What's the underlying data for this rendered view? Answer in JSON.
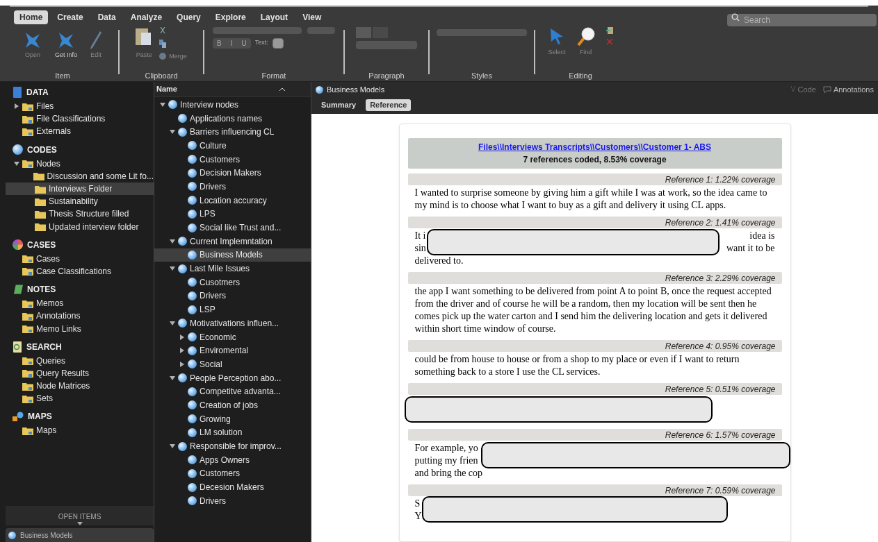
{
  "ribbon": {
    "tabs": [
      {
        "label": "Home",
        "selected": true
      },
      {
        "label": "Create",
        "selected": false
      },
      {
        "label": "Data",
        "selected": false
      },
      {
        "label": "Analyze",
        "selected": false
      },
      {
        "label": "Query",
        "selected": false
      },
      {
        "label": "Explore",
        "selected": false
      },
      {
        "label": "Layout",
        "selected": false
      },
      {
        "label": "View",
        "selected": false
      }
    ],
    "search": {
      "placeholder": "Search"
    },
    "item_buttons": [
      {
        "label": "Open",
        "disabled": true
      },
      {
        "label": "Get Info",
        "disabled": false
      },
      {
        "label": "Edit",
        "disabled": true
      }
    ],
    "clipboard": {
      "paste": "Paste",
      "merge": "Merge"
    },
    "format": {
      "bold": "B",
      "italic": "I",
      "underline": "U",
      "text_label": "Text:"
    },
    "editing": [
      {
        "label": "Select",
        "kind": "select"
      },
      {
        "label": "Find",
        "kind": "find"
      }
    ],
    "groups": [
      "Item",
      "Clipboard",
      "Format",
      "Paragraph",
      "Styles",
      "Editing"
    ]
  },
  "sidebar": {
    "sections": [
      {
        "title": "DATA",
        "kind": "data",
        "items": [
          {
            "label": "Files",
            "expandable": true,
            "selected": false
          },
          {
            "label": "File Classifications",
            "selected": false
          },
          {
            "label": "Externals",
            "selected": false
          }
        ]
      },
      {
        "title": "CODES",
        "kind": "codes",
        "items": [
          {
            "label": "Nodes",
            "expanded": true,
            "selected": false,
            "children": [
              {
                "label": "Discussion and some Lit fo...",
                "selected": false
              },
              {
                "label": "Interviews Folder",
                "selected": true
              },
              {
                "label": "Sustainability",
                "selected": false
              },
              {
                "label": "Thesis Structure filled",
                "selected": false
              },
              {
                "label": "Updated interview folder",
                "selected": false
              }
            ]
          }
        ]
      },
      {
        "title": "CASES",
        "kind": "cases",
        "items": [
          {
            "label": "Cases",
            "selected": false
          },
          {
            "label": "Case Classifications",
            "selected": false
          }
        ]
      },
      {
        "title": "NOTES",
        "kind": "notes",
        "items": [
          {
            "label": "Memos",
            "selected": false
          },
          {
            "label": "Annotations",
            "selected": false
          },
          {
            "label": "Memo Links",
            "selected": false
          }
        ]
      },
      {
        "title": "SEARCH",
        "kind": "search",
        "items": [
          {
            "label": "Queries",
            "selected": false
          },
          {
            "label": "Query Results",
            "selected": false
          },
          {
            "label": "Node Matrices",
            "selected": false
          },
          {
            "label": "Sets",
            "selected": false
          }
        ]
      },
      {
        "title": "MAPS",
        "kind": "maps",
        "items": [
          {
            "label": "Maps",
            "selected": false
          }
        ]
      }
    ],
    "open_items": {
      "title": "OPEN ITEMS",
      "items": [
        "Business Models"
      ]
    }
  },
  "node_list": {
    "column": "Name",
    "nodes": [
      {
        "label": "Interview nodes",
        "expanded": true,
        "selected": false,
        "children": [
          {
            "label": "Applications names",
            "selected": false
          },
          {
            "label": "Barriers influencing  CL",
            "expanded": true,
            "selected": false,
            "children": [
              {
                "label": "Culture",
                "selected": false
              },
              {
                "label": "Customers",
                "selected": false
              },
              {
                "label": "Decision Makers",
                "selected": false
              },
              {
                "label": "Drivers",
                "selected": false
              },
              {
                "label": "Location accuracy",
                "selected": false
              },
              {
                "label": "LPS",
                "selected": false
              },
              {
                "label": "Social like Trust and...",
                "selected": false
              }
            ]
          },
          {
            "label": "Current Implemntation",
            "expanded": true,
            "selected": false,
            "children": [
              {
                "label": "Business Models",
                "selected": true
              }
            ]
          },
          {
            "label": "Last Mile Issues",
            "expanded": true,
            "selected": false,
            "children": [
              {
                "label": "Cusotmers",
                "selected": false
              },
              {
                "label": "Drivers",
                "selected": false
              },
              {
                "label": "LSP",
                "selected": false
              }
            ]
          },
          {
            "label": "Motivativations influen...",
            "expanded": true,
            "selected": false,
            "children": [
              {
                "label": "Economic",
                "expandable": true,
                "selected": false
              },
              {
                "label": "Enviromental",
                "expandable": true,
                "selected": false
              },
              {
                "label": "Social",
                "expandable": true,
                "selected": false
              }
            ]
          },
          {
            "label": "People Perception abo...",
            "expanded": true,
            "selected": false,
            "children": [
              {
                "label": "Competitve advanta...",
                "selected": false
              },
              {
                "label": "Creation of jobs",
                "selected": false
              },
              {
                "label": "Growing",
                "selected": false
              },
              {
                "label": "LM solution",
                "selected": false
              }
            ]
          },
          {
            "label": "Responsible for improv...",
            "expanded": true,
            "selected": false,
            "children": [
              {
                "label": "Apps Owners",
                "selected": false
              },
              {
                "label": "Customers",
                "selected": false
              },
              {
                "label": "Decesion Makers",
                "selected": false
              },
              {
                "label": "Drivers",
                "selected": false
              }
            ]
          }
        ]
      }
    ]
  },
  "detail": {
    "title": "Business Models",
    "actions": [
      "Code",
      "Annotations"
    ],
    "tabs": [
      {
        "label": "Summary",
        "selected": false
      },
      {
        "label": "Reference",
        "selected": true
      }
    ],
    "source": {
      "link": "Files\\\\Interviews Transcripts\\\\Customers\\\\Customer 1- ABS",
      "summary": "7 references coded, 8.53% coverage"
    },
    "references": [
      {
        "label": "Reference 1: 1.22% coverage",
        "kind": "text",
        "text": "I wanted to surprise someone by giving him a gift while I was at work, so the idea came to my mind is to choose what I want to buy as a gift and delivery it using CL apps."
      },
      {
        "label": "Reference 2: 1.41% coverage",
        "kind": "redacted",
        "lines": [
          {
            "left": "It i",
            "right": "idea is"
          },
          {
            "left": "sin",
            "right": "want it to be"
          },
          {
            "left": "delivered to."
          }
        ]
      },
      {
        "label": "Reference 3: 2.29% coverage",
        "kind": "text",
        "text": "the app I want something to be delivered from point A to point B, once the request accepted from the driver and of course he will be a random, then my location will be sent then he comes pick up the water carton and I send him the delivering location and gets it delivered within short time window of course."
      },
      {
        "label": "Reference 4: 0.95% coverage",
        "kind": "text",
        "text": "could be from house to house or from a shop to my place or even if I want to return something back to a store I use the CL services."
      },
      {
        "label": "Reference 5: 0.51% coverage",
        "kind": "redacted"
      },
      {
        "label": "Reference 6: 1.57% coverage",
        "kind": "redacted",
        "lines": [
          {
            "left": "For example, yo"
          },
          {
            "left": "putting my frien"
          },
          {
            "left": "and bring the cop"
          }
        ]
      },
      {
        "label": "Reference 7: 0.59% coverage",
        "kind": "redacted",
        "lines": [
          {
            "left": "S"
          },
          {
            "left": "Y"
          }
        ]
      }
    ]
  }
}
